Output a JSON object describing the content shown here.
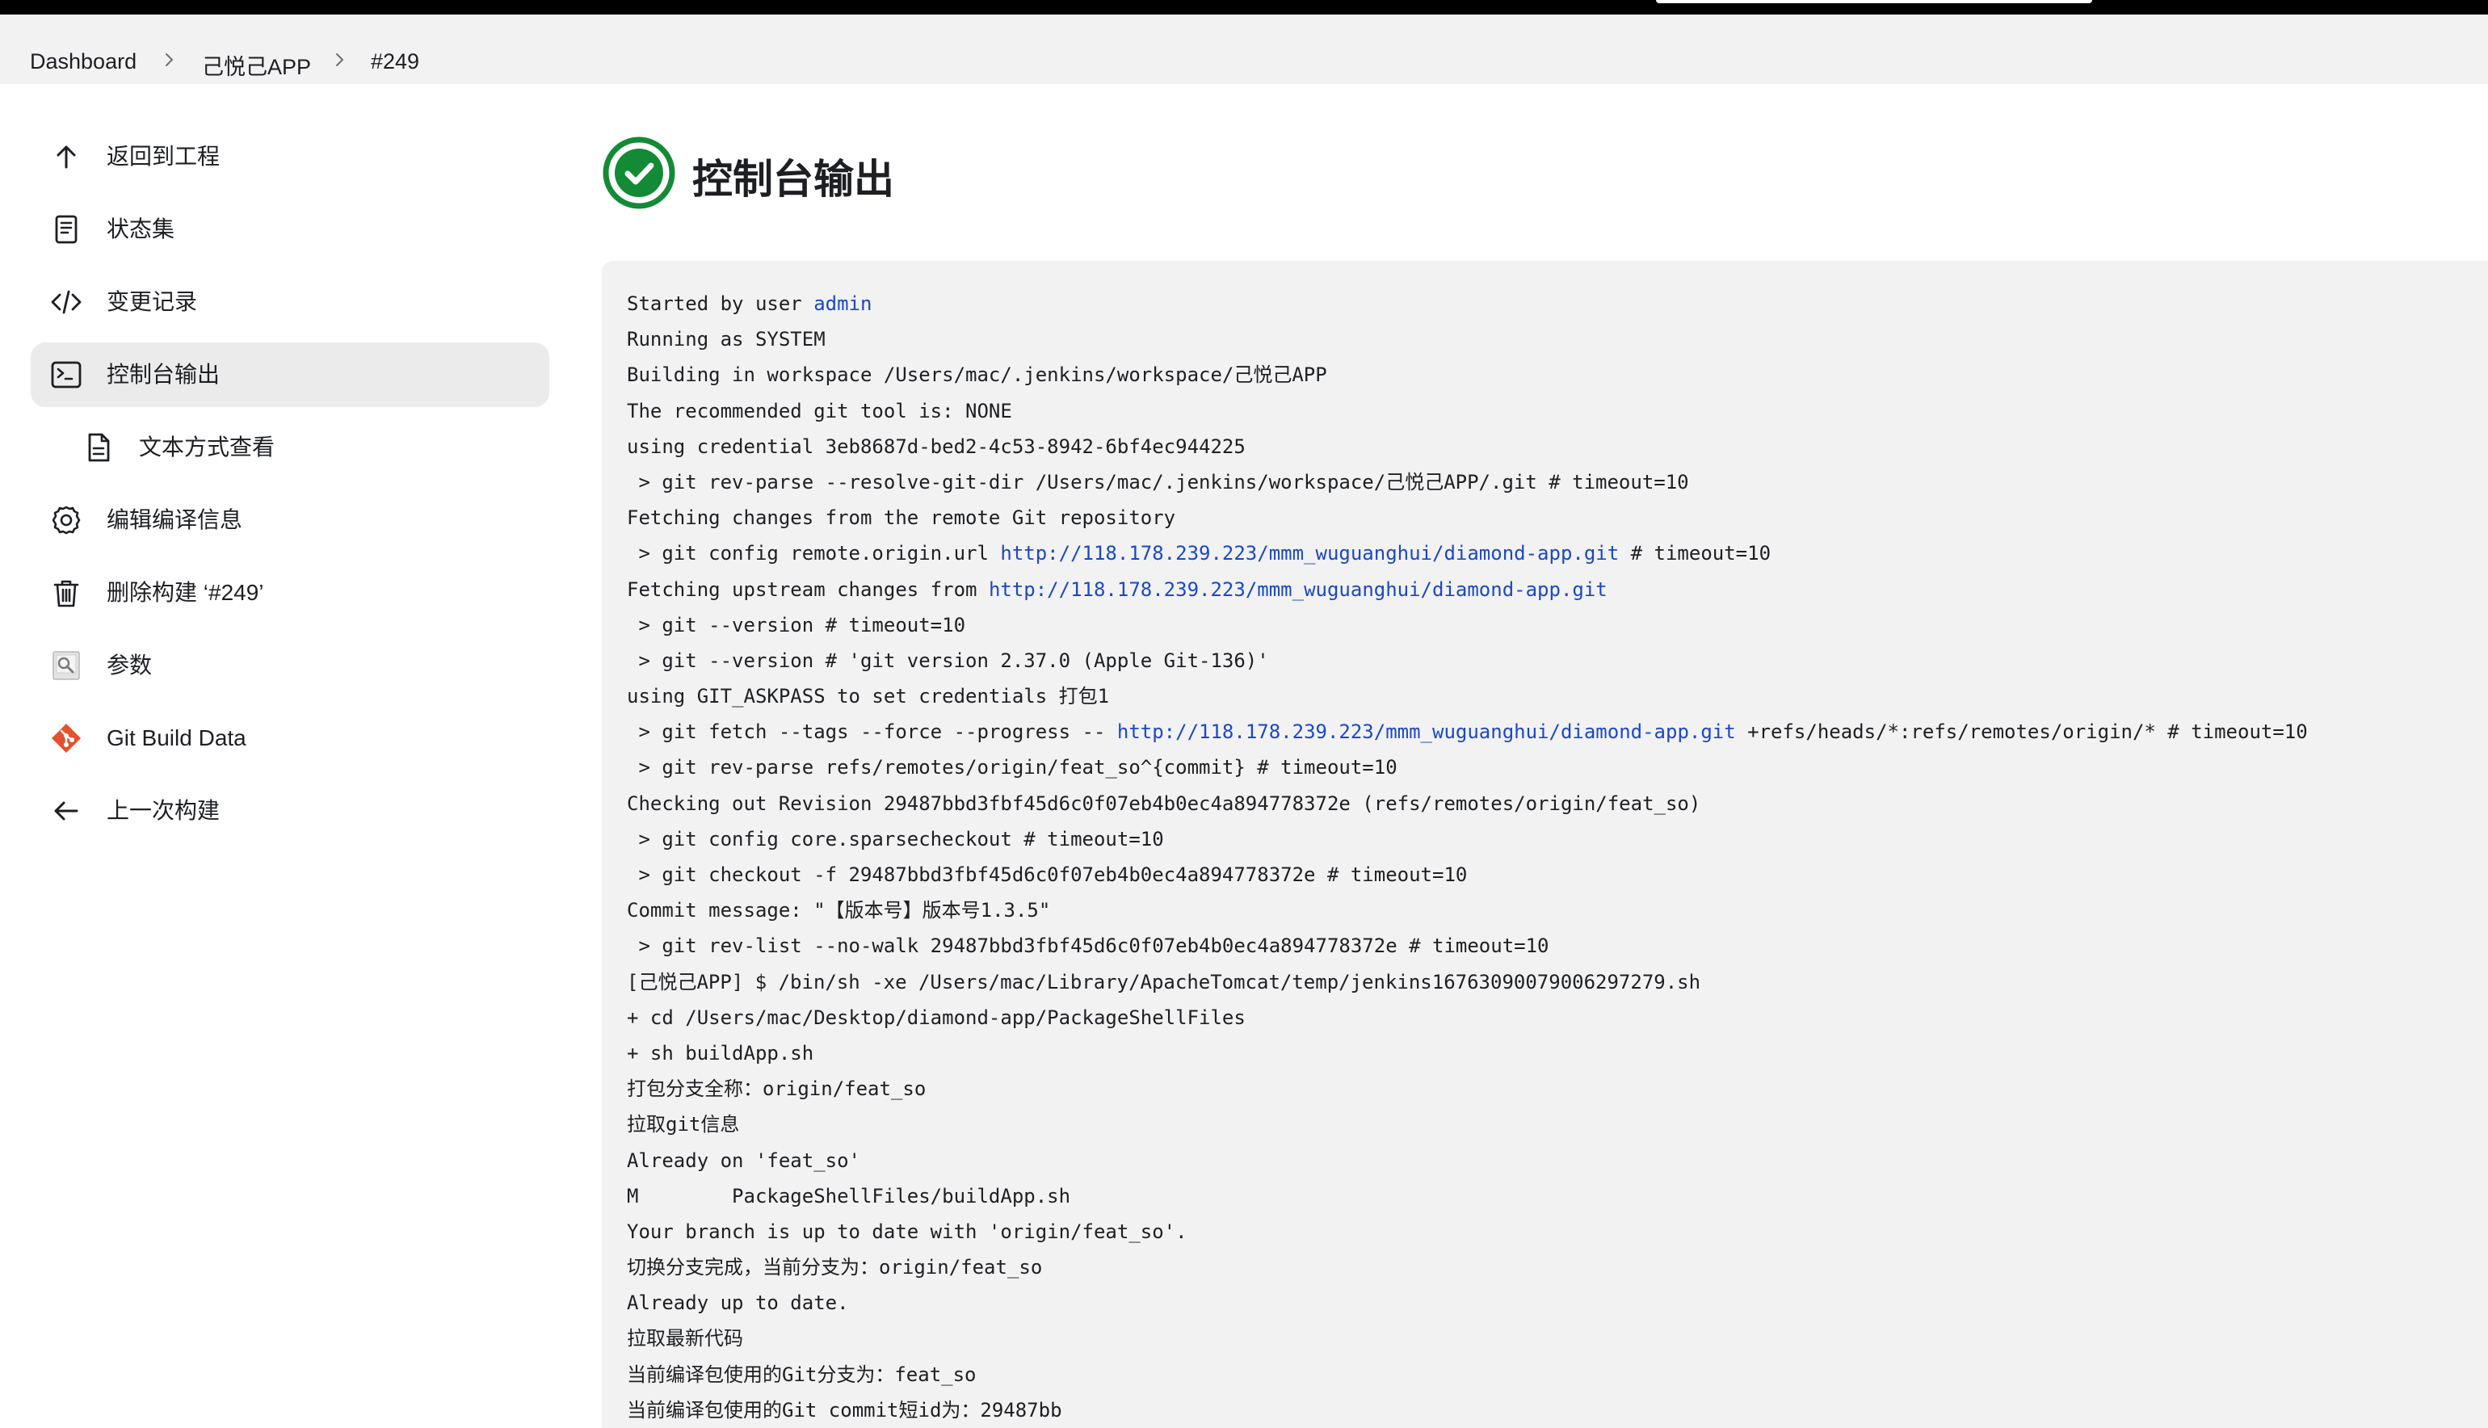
{
  "breadcrumb": {
    "items": [
      {
        "label": "Dashboard"
      },
      {
        "label": "己悦己APP"
      },
      {
        "label": "#249"
      }
    ]
  },
  "sidebar": {
    "items": [
      {
        "label": "返回到工程",
        "icon": "arrow-up-icon"
      },
      {
        "label": "状态集",
        "icon": "document-icon"
      },
      {
        "label": "变更记录",
        "icon": "code-icon"
      },
      {
        "label": "控制台输出",
        "icon": "terminal-icon",
        "active": true
      },
      {
        "label": "文本方式查看",
        "icon": "file-icon"
      },
      {
        "label": "编辑编译信息",
        "icon": "gear-icon"
      },
      {
        "label": "删除构建 ‘#249’",
        "icon": "trash-icon"
      },
      {
        "label": "参数",
        "icon": "parameters-icon"
      },
      {
        "label": "Git Build Data",
        "icon": "git-icon"
      },
      {
        "label": "上一次构建",
        "icon": "arrow-left-icon"
      }
    ]
  },
  "main": {
    "title": "控制台输出",
    "status": "success",
    "status_color": "#138a36"
  },
  "console": {
    "link_color": "#1b47c8",
    "lines": [
      [
        {
          "t": "Started by user "
        },
        {
          "t": "admin",
          "link": true
        }
      ],
      [
        {
          "t": "Running as SYSTEM"
        }
      ],
      [
        {
          "t": "Building in workspace /Users/mac/.jenkins/workspace/己悦己APP"
        }
      ],
      [
        {
          "t": "The recommended git tool is: NONE"
        }
      ],
      [
        {
          "t": "using credential 3eb8687d-bed2-4c53-8942-6bf4ec944225"
        }
      ],
      [
        {
          "t": " > git rev-parse --resolve-git-dir /Users/mac/.jenkins/workspace/己悦己APP/.git # timeout=10"
        }
      ],
      [
        {
          "t": "Fetching changes from the remote Git repository"
        }
      ],
      [
        {
          "t": " > git config remote.origin.url "
        },
        {
          "t": "http://118.178.239.223/mmm_wuguanghui/diamond-app.git",
          "link": true
        },
        {
          "t": " # timeout=10"
        }
      ],
      [
        {
          "t": "Fetching upstream changes from "
        },
        {
          "t": "http://118.178.239.223/mmm_wuguanghui/diamond-app.git",
          "link": true
        }
      ],
      [
        {
          "t": " > git --version # timeout=10"
        }
      ],
      [
        {
          "t": " > git --version # 'git version 2.37.0 (Apple Git-136)'"
        }
      ],
      [
        {
          "t": "using GIT_ASKPASS to set credentials 打包1"
        }
      ],
      [
        {
          "t": " > git fetch --tags --force --progress -- "
        },
        {
          "t": "http://118.178.239.223/mmm_wuguanghui/diamond-app.git",
          "link": true
        },
        {
          "t": " +refs/heads/*:refs/remotes/origin/* # timeout=10"
        }
      ],
      [
        {
          "t": " > git rev-parse refs/remotes/origin/feat_so^{commit} # timeout=10"
        }
      ],
      [
        {
          "t": "Checking out Revision 29487bbd3fbf45d6c0f07eb4b0ec4a894778372e (refs/remotes/origin/feat_so)"
        }
      ],
      [
        {
          "t": " > git config core.sparsecheckout # timeout=10"
        }
      ],
      [
        {
          "t": " > git checkout -f 29487bbd3fbf45d6c0f07eb4b0ec4a894778372e # timeout=10"
        }
      ],
      [
        {
          "t": "Commit message: \"【版本号】版本号1.3.5\""
        }
      ],
      [
        {
          "t": " > git rev-list --no-walk 29487bbd3fbf45d6c0f07eb4b0ec4a894778372e # timeout=10"
        }
      ],
      [
        {
          "t": "[己悦己APP] $ /bin/sh -xe /Users/mac/Library/ApacheTomcat/temp/jenkins16763090079006297279.sh"
        }
      ],
      [
        {
          "t": "+ cd /Users/mac/Desktop/diamond-app/PackageShellFiles"
        }
      ],
      [
        {
          "t": "+ sh buildApp.sh"
        }
      ],
      [
        {
          "t": "打包分支全称：origin/feat_so"
        }
      ],
      [
        {
          "t": "拉取git信息"
        }
      ],
      [
        {
          "t": "Already on 'feat_so'"
        }
      ],
      [
        {
          "t": "M        PackageShellFiles/buildApp.sh"
        }
      ],
      [
        {
          "t": "Your branch is up to date with 'origin/feat_so'."
        }
      ],
      [
        {
          "t": "切换分支完成，当前分支为：origin/feat_so"
        }
      ],
      [
        {
          "t": "Already up to date."
        }
      ],
      [
        {
          "t": "拉取最新代码"
        }
      ],
      [
        {
          "t": "当前编译包使用的Git分支为：feat_so"
        }
      ],
      [
        {
          "t": "当前编译包使用的Git commit短id为：29487bb"
        }
      ]
    ]
  }
}
